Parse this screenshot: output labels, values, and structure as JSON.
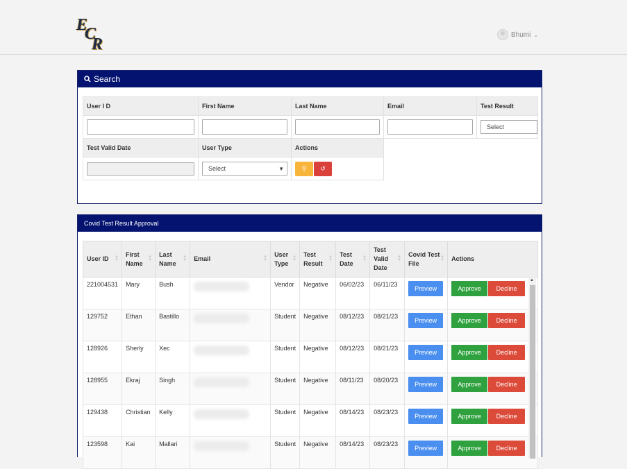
{
  "header": {
    "logo_letters": [
      "E",
      "C",
      "R"
    ],
    "user_name": "Bhumi"
  },
  "search": {
    "title": "Search",
    "labels": {
      "user_id": "User I D",
      "first_name": "First Name",
      "last_name": "Last Name",
      "email": "Email",
      "test_result": "Test Result",
      "test_valid_date": "Test Valid Date",
      "user_type": "User Type",
      "actions": "Actions"
    },
    "test_result_select": "Select",
    "user_type_select": "Select"
  },
  "approval": {
    "title": "Covid Test Result Approval",
    "columns": [
      "User ID",
      "First Name",
      "Last Name",
      "Email",
      "User Type",
      "Test Result",
      "Test Date",
      "Test Valid Date",
      "Covid Test File",
      "Actions"
    ],
    "preview_label": "Preview",
    "approve_label": "Approve",
    "decline_label": "Decline",
    "rows": [
      {
        "user_id": "221004531",
        "first_name": "Mary",
        "last_name": "Bush",
        "user_type": "Vendor",
        "test_result": "Negative",
        "test_date": "06/02/23",
        "valid_date": "06/11/23"
      },
      {
        "user_id": "129752",
        "first_name": "Ethan",
        "last_name": "Bastillo",
        "user_type": "Student",
        "test_result": "Negative",
        "test_date": "08/12/23",
        "valid_date": "08/21/23"
      },
      {
        "user_id": "128926",
        "first_name": "Sherly",
        "last_name": "Xec",
        "user_type": "Student",
        "test_result": "Negative",
        "test_date": "08/12/23",
        "valid_date": "08/21/23"
      },
      {
        "user_id": "128955",
        "first_name": "Ekraj",
        "last_name": "Singh",
        "user_type": "Student",
        "test_result": "Negative",
        "test_date": "08/11/23",
        "valid_date": "08/20/23"
      },
      {
        "user_id": "129438",
        "first_name": "Christian",
        "last_name": "Kelly",
        "user_type": "Student",
        "test_result": "Negative",
        "test_date": "08/14/23",
        "valid_date": "08/23/23"
      },
      {
        "user_id": "123598",
        "first_name": "Kai",
        "last_name": "Mallari",
        "user_type": "Student",
        "test_result": "Negative",
        "test_date": "08/14/23",
        "valid_date": "08/23/23"
      }
    ]
  }
}
